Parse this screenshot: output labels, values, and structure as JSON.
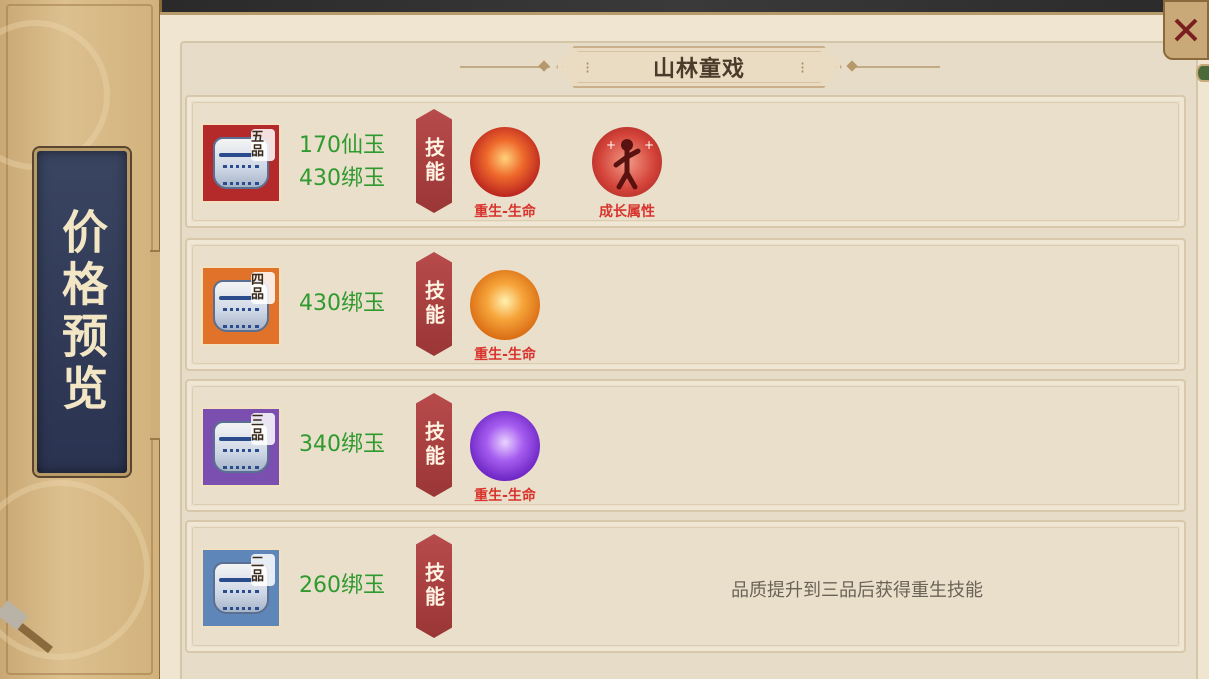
{
  "side_title": "价格预览",
  "header": {
    "title": "山林童戏"
  },
  "skill_tag_label": "技能",
  "rows": [
    {
      "grade": "五品",
      "grade_color": "#b42a2a",
      "prices": [
        "170仙玉",
        "430绑玉"
      ],
      "skills": [
        {
          "label": "重生-生命",
          "icon": "phoenix-red-icon",
          "color": "#d9492f"
        },
        {
          "label": "成长属性",
          "icon": "growth-figure-icon",
          "color": "#c7312e"
        }
      ],
      "note": ""
    },
    {
      "grade": "四品",
      "grade_color": "#e0722a",
      "prices": [
        "430绑玉"
      ],
      "skills": [
        {
          "label": "重生-生命",
          "icon": "phoenix-orange-icon",
          "color": "#e07a1e"
        }
      ],
      "note": ""
    },
    {
      "grade": "三品",
      "grade_color": "#7a4fb0",
      "prices": [
        "340绑玉"
      ],
      "skills": [
        {
          "label": "重生-生命",
          "icon": "phoenix-purple-icon",
          "color": "#7a36c9"
        }
      ],
      "note": ""
    },
    {
      "grade": "二品",
      "grade_color": "#5f86b8",
      "prices": [
        "260绑玉"
      ],
      "skills": [],
      "note": "品质提升到三品后获得重生技能"
    }
  ]
}
